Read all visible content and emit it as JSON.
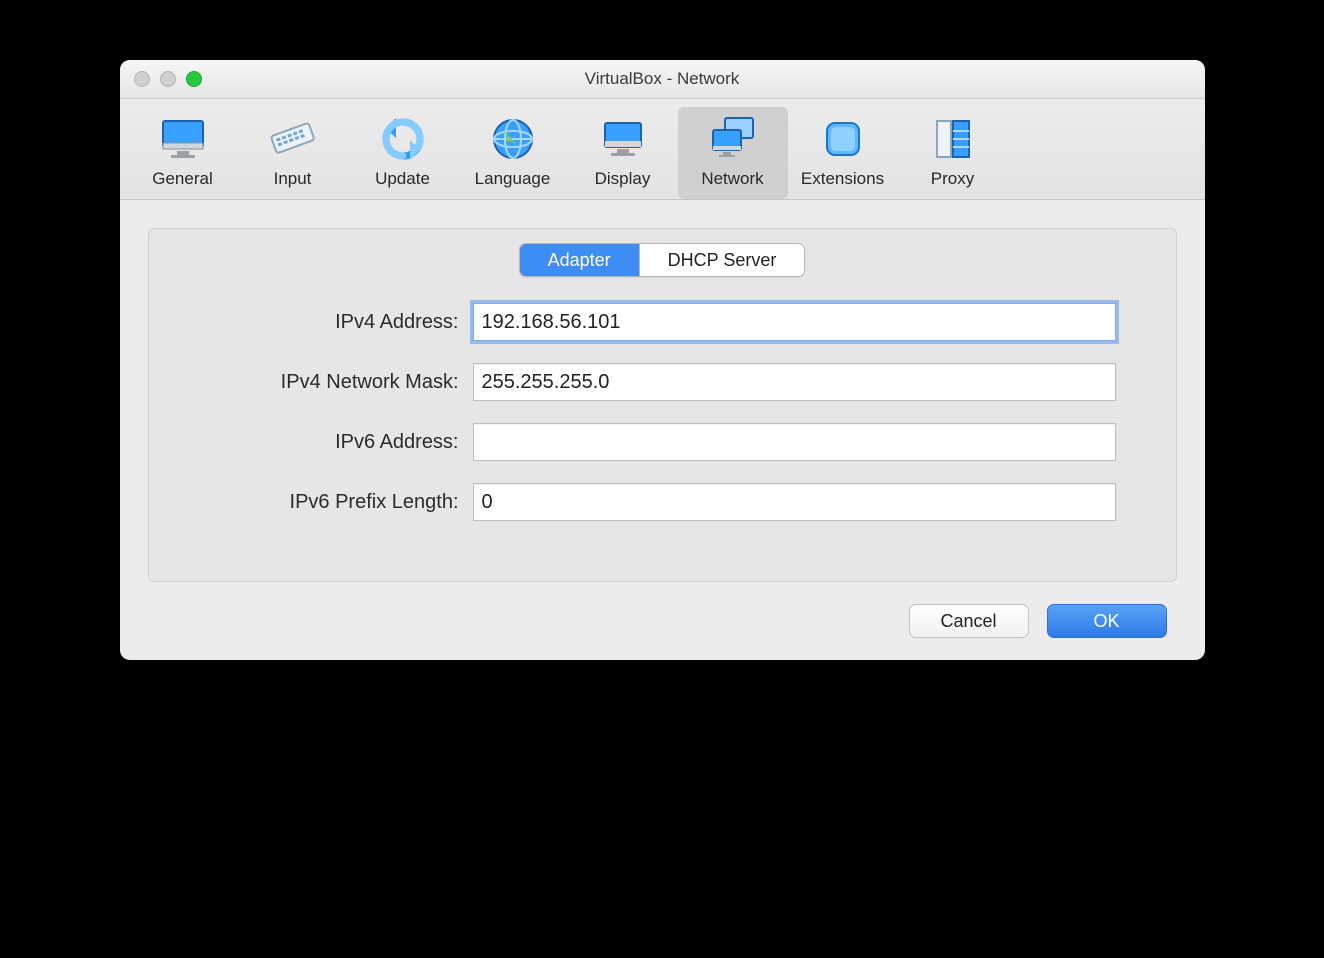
{
  "window": {
    "title": "VirtualBox - Network"
  },
  "toolbar": {
    "items": [
      {
        "label": "General"
      },
      {
        "label": "Input"
      },
      {
        "label": "Update"
      },
      {
        "label": "Language"
      },
      {
        "label": "Display"
      },
      {
        "label": "Network",
        "active": true
      },
      {
        "label": "Extensions"
      },
      {
        "label": "Proxy"
      }
    ]
  },
  "tabs": {
    "adapter": "Adapter",
    "dhcp": "DHCP Server",
    "selected": "adapter"
  },
  "form": {
    "ipv4_address": {
      "label": "IPv4 Address:",
      "value": "192.168.56.101"
    },
    "ipv4_mask": {
      "label": "IPv4 Network Mask:",
      "value": "255.255.255.0"
    },
    "ipv6_address": {
      "label": "IPv6 Address:",
      "value": ""
    },
    "ipv6_prefix": {
      "label": "IPv6 Prefix Length:",
      "value": "0"
    }
  },
  "buttons": {
    "cancel": "Cancel",
    "ok": "OK"
  },
  "colors": {
    "accent": "#3e8df5"
  }
}
